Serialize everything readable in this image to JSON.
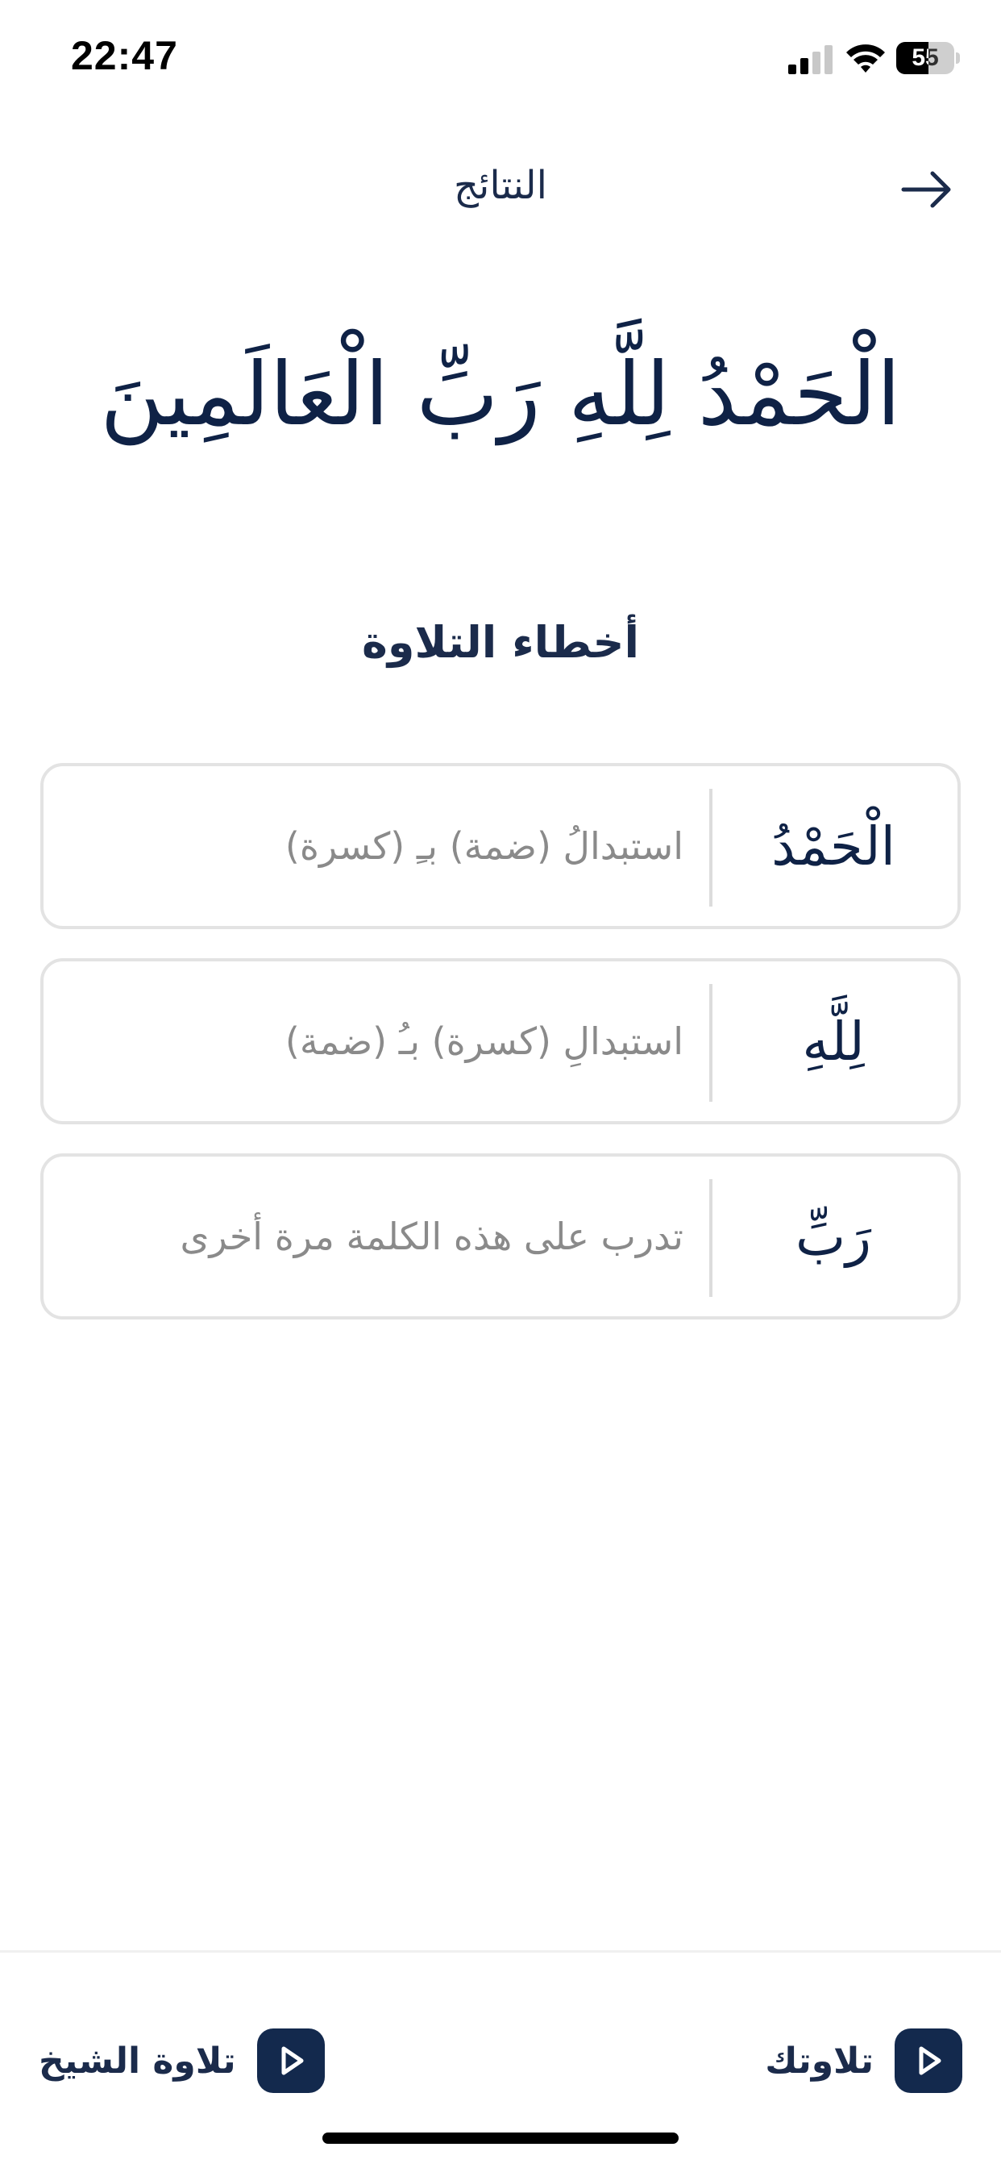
{
  "status_bar": {
    "time": "22:47",
    "battery_level": "55",
    "battery_fraction": 0.55
  },
  "header": {
    "title": "النتائج",
    "back_icon": "arrow-right-icon"
  },
  "verse": "الْحَمْدُ لِلَّهِ رَبِّ الْعَالَمِينَ",
  "section_title": "أخطاء التلاوة",
  "errors": [
    {
      "word": "الْحَمْدُ",
      "description": "استبدالُ (ضمة) بـِ (كسرة)"
    },
    {
      "word": "لِلَّهِ",
      "description": "استبدالِ (كسرة) بـُ (ضمة)"
    },
    {
      "word": "رَبِّ",
      "description": "تدرب على هذه الكلمة مرة أخرى"
    }
  ],
  "bottom_bar": {
    "my_recitation_label": "تلاوتك",
    "sheikh_recitation_label": "تلاوة الشيخ",
    "play_icon": "play-icon"
  },
  "colors": {
    "primary": "#13294d",
    "text_dark": "#1b2b4b",
    "text_muted": "#8a8a8a",
    "card_border": "#e3e3e3"
  }
}
